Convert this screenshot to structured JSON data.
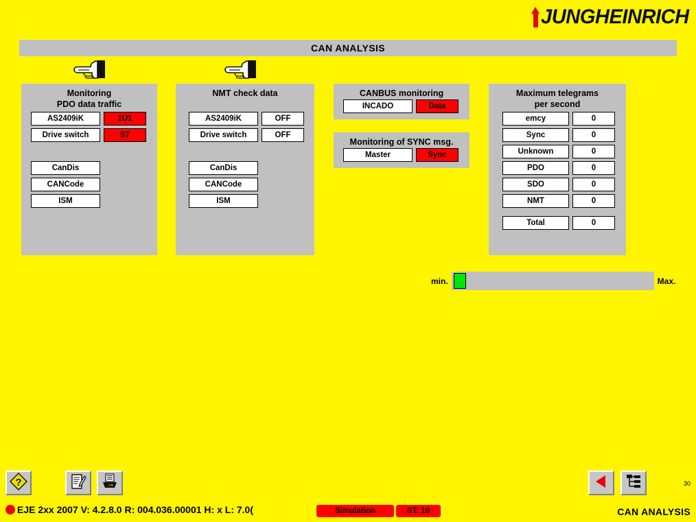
{
  "brand": {
    "name": "JUNGHEINRICH",
    "logo_icon": "jungheinrich-arrow-logo",
    "accent_color": "#E30613"
  },
  "title_bar": {
    "title": "CAN ANALYSIS"
  },
  "colors": {
    "page_background": "#FFF500",
    "panel": "#C0C0C0",
    "alarm": "#FF0000",
    "ok": "#00E800"
  },
  "panels": {
    "monitoring_pdo": {
      "title_line1": "Monitoring",
      "title_line2": "PDO data traffic",
      "hand_icon": "pointing-hand-icon",
      "rows": [
        {
          "label": "AS2409iK",
          "value": "1U1",
          "state": "alarm"
        },
        {
          "label": "Drive switch",
          "value": "S7",
          "state": "alarm"
        }
      ],
      "buttons": [
        "CanDis",
        "CANCode",
        "ISM"
      ]
    },
    "nmt_check": {
      "title_line1": "NMT check data",
      "title_line2": "",
      "hand_icon": "pointing-hand-icon",
      "rows": [
        {
          "label": "AS2409iK",
          "value": "OFF",
          "state": "normal"
        },
        {
          "label": "Drive switch",
          "value": "OFF",
          "state": "normal"
        }
      ],
      "buttons": [
        "CanDis",
        "CANCode",
        "ISM"
      ]
    },
    "canbus_monitoring": {
      "title_line1": "CANBUS monitoring",
      "rows": [
        {
          "label": "INCADO",
          "value": "Data",
          "state": "alarm"
        }
      ]
    },
    "sync_monitoring": {
      "title_line1": "Monitoring of SYNC msg.",
      "rows": [
        {
          "label": "Master",
          "value": "Sync",
          "state": "alarm"
        }
      ]
    },
    "max_telegrams": {
      "title_line1": "Maximum telegrams",
      "title_line2": "per second",
      "rows": [
        {
          "label": "emcy",
          "value": "0"
        },
        {
          "label": "Sync",
          "value": "0"
        },
        {
          "label": "Unknown",
          "value": "0"
        },
        {
          "label": "PDO",
          "value": "0"
        },
        {
          "label": "SDO",
          "value": "0"
        },
        {
          "label": "NMT",
          "value": "0"
        }
      ],
      "total": {
        "label": "Total",
        "value": "0"
      }
    }
  },
  "gauge": {
    "min_label": "min.",
    "max_label": "Max.",
    "fill_percent": 6
  },
  "toolbar": {
    "help_icon": "help-diamond-icon",
    "notes_icon": "edit-document-icon",
    "print_icon": "printer-icon",
    "back_icon": "back-arrow-icon",
    "tree_icon": "tree-structure-icon"
  },
  "status": {
    "indicator_icon": "status-dot-icon",
    "text": "EJE  2xx  2007  V: 4.2.8.0  R: 004.036.00001  H: x  L: 7.0(",
    "simulation_label": "Simulation",
    "st_label": "ST: 10"
  },
  "footer": {
    "page_number": "30",
    "screen_label": "CAN ANALYSIS"
  }
}
